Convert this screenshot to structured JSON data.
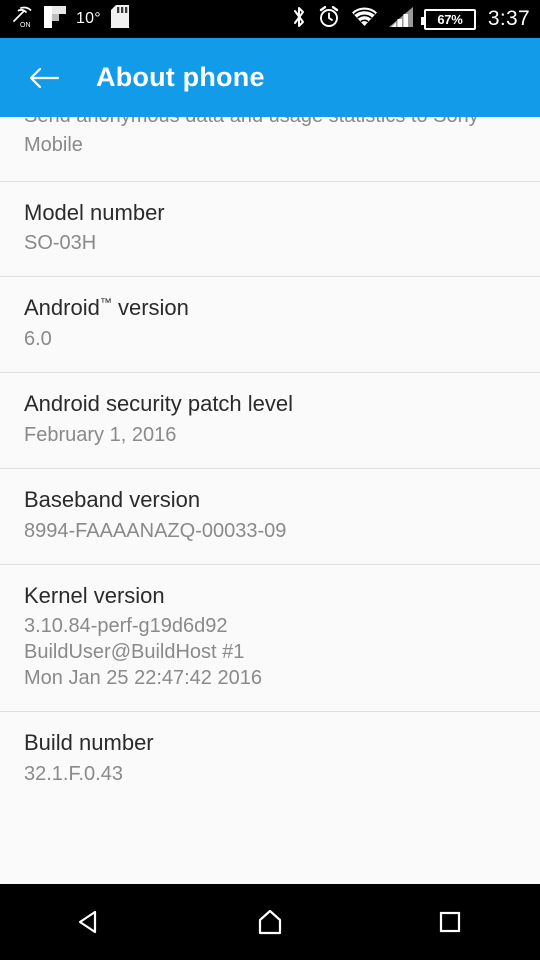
{
  "status_bar": {
    "left_icons": [
      {
        "name": "vibrate-on-icon",
        "label": "ON"
      },
      {
        "name": "flipboard-icon",
        "label": ""
      },
      {
        "name": "sd-card-icon",
        "label": ""
      }
    ],
    "temperature": "10°",
    "right_icons": [
      {
        "name": "bluetooth-icon"
      },
      {
        "name": "alarm-clock-icon"
      },
      {
        "name": "wifi-icon"
      },
      {
        "name": "cellular-signal-icon"
      }
    ],
    "battery_percent": "67%",
    "clock": "3:37"
  },
  "app_bar": {
    "back_label": "Back",
    "title": "About phone",
    "background_color": "#129be8"
  },
  "list": {
    "clipped_row": {
      "line1": "Send anonymous data and usage statistics to Sony",
      "line2": "Mobile"
    },
    "items": [
      {
        "title": "Model number",
        "values": [
          "SO-03H"
        ]
      },
      {
        "title": "Android™ version",
        "title_main": "Android",
        "title_tm": "™",
        "title_rest": " version",
        "values": [
          "6.0"
        ]
      },
      {
        "title": "Android security patch level",
        "values": [
          "February 1, 2016"
        ]
      },
      {
        "title": "Baseband version",
        "values": [
          "8994-FAAAANAZQ-00033-09"
        ]
      },
      {
        "title": "Kernel version",
        "values": [
          "3.10.84-perf-g19d6d92",
          "BuildUser@BuildHost #1",
          "Mon Jan 25 22:47:42 2016"
        ]
      },
      {
        "title": "Build number",
        "values": [
          "32.1.F.0.43"
        ]
      }
    ]
  },
  "nav_bar": {
    "buttons": [
      {
        "name": "back-nav-button",
        "label": "Back"
      },
      {
        "name": "home-nav-button",
        "label": "Home"
      },
      {
        "name": "recents-nav-button",
        "label": "Recent apps"
      }
    ]
  },
  "colors": {
    "accent": "#129be8",
    "background": "#fafafa",
    "divider": "#e0e0e0",
    "primary_text": "#2b2b2b",
    "secondary_text": "#8a8a8a",
    "system_bar": "#000000"
  }
}
